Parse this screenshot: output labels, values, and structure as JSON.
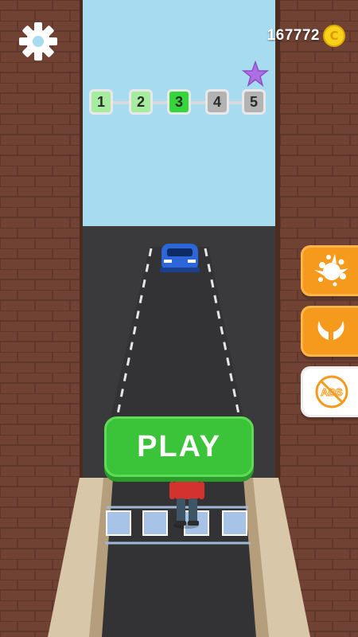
{
  "hud": {
    "coins": "167772",
    "coin_symbol": "C"
  },
  "levels": [
    {
      "label": "1",
      "state": "done"
    },
    {
      "label": "2",
      "state": "done"
    },
    {
      "label": "3",
      "state": "current"
    },
    {
      "label": "4",
      "state": "locked"
    },
    {
      "label": "5",
      "state": "locked"
    }
  ],
  "side_buttons": [
    {
      "name": "paint-splat-button",
      "icon": "paint-splat-icon"
    },
    {
      "name": "wings-button",
      "icon": "wings-icon"
    },
    {
      "name": "no-ads-button",
      "icon": "no-ads-icon",
      "icon_text": "ADS"
    }
  ],
  "play": {
    "label": "PLAY"
  },
  "colors": {
    "brick": "#6b3f30",
    "road": "#3b3b3d",
    "sky": "#a7dcf0",
    "play_green": "#3bc43a",
    "orange": "#f59a1c",
    "car_blue": "#2c66d8"
  }
}
